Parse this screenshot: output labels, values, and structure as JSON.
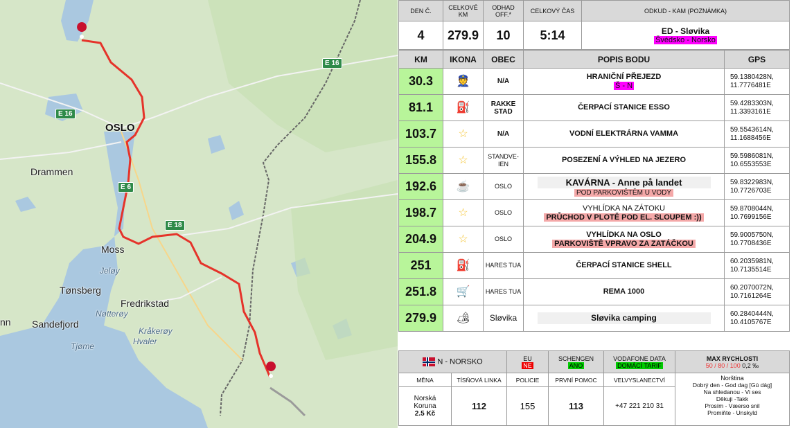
{
  "map": {
    "labels": {
      "oslo": "OSLO",
      "drammen": "Drammen",
      "moss": "Moss",
      "jeloy": "Jeløy",
      "tonsberg": "Tønsberg",
      "fredrikstad": "Fredrikstad",
      "sandefjord": "Sandefjord",
      "notteroy": "Nøtterøy",
      "kraakeroy": "Kråkerøy",
      "hvaler": "Hvaler",
      "tjome": "Tjøme",
      "nn": "nn"
    },
    "roads": [
      "E 16",
      "E 16",
      "E 16",
      "E 6",
      "E 18"
    ]
  },
  "summary": {
    "headers": [
      "DEN Č.",
      "CELKOVÉ KM",
      "ODHAD OFF.*",
      "CELKOVÝ ČAS",
      "ODKUD - KAM (POZNÁMKA)"
    ],
    "den": "4",
    "km": "279.9",
    "odhad": "10",
    "cas": "5:14",
    "route": "ED - Sløvika",
    "route_note": "Švédsko - Norsko"
  },
  "points": {
    "headers": [
      "KM",
      "IKONA",
      "OBEC",
      "POPIS BODU",
      "GPS"
    ],
    "rows": [
      {
        "km": "30.3",
        "icon": "border-officer-icon",
        "obec": "N/A",
        "desc": "HRANIČNÍ PŘEJEZD",
        "note": "Š - N",
        "gps1": "59.1380428N,",
        "gps2": "11.7776481E"
      },
      {
        "km": "81.1",
        "icon": "fuel-pump-icon",
        "obec": "RAKKE STAD",
        "desc": "ČERPACÍ STANICE ESSO",
        "note": "",
        "gps1": "59.4283303N,",
        "gps2": "11.3393161E"
      },
      {
        "km": "103.7",
        "icon": "star-icon",
        "obec": "N/A",
        "desc": "VODNÍ ELEKTRÁRNA VAMMA",
        "note": "",
        "gps1": "59.5543614N,",
        "gps2": "11.1688456E"
      },
      {
        "km": "155.8",
        "icon": "star-icon",
        "obec": "STANDVE-IEN",
        "desc": "POSEZENÍ A VÝHLED NA JEZERO",
        "note": "",
        "gps1": "59.5986081N,",
        "gps2": "10.6553553E"
      },
      {
        "km": "192.6",
        "icon": "coffee-cup-icon",
        "obec": "OSLO",
        "desc": "KAVÁRNA - Anne på landet",
        "note": "POD PARKOVIŠTĚM U VODY",
        "gps1": "59.8322983N,",
        "gps2": "10.7726703E"
      },
      {
        "km": "198.7",
        "icon": "star-icon",
        "obec": "OSLO",
        "desc": "VYHLÍDKA NA ZÁTOKU",
        "note": "PRŮCHOD V PLOTĚ POD EL. SLOUPEM :))",
        "gps1": "59.8708044N,",
        "gps2": "10.7699156E"
      },
      {
        "km": "204.9",
        "icon": "star-icon",
        "obec": "OSLO",
        "desc": "VYHLÍDKA NA OSLO",
        "note": "PARKOVIŠTĚ VPRAVO ZA ZATÁČKOU",
        "gps1": "59.9005750N,",
        "gps2": "10.7708436E"
      },
      {
        "km": "251",
        "icon": "fuel-pump-icon",
        "obec": "HARES TUA",
        "desc": "ČERPACÍ STANICE SHELL",
        "note": "",
        "gps1": "60.2035981N,",
        "gps2": "10.7135514E"
      },
      {
        "km": "251.8",
        "icon": "shopping-cart-icon",
        "obec": "HARES TUA",
        "desc": "REMA 1000",
        "note": "",
        "gps1": "60.2070072N,",
        "gps2": "10.7161264E"
      },
      {
        "km": "279.9",
        "icon": "camping-icon",
        "obec": "Sløvika",
        "desc": "Sløvika camping",
        "note": "",
        "gps1": "60.2840444N,",
        "gps2": "10.4105767E"
      }
    ]
  },
  "country": {
    "name": "N - NORSKO",
    "eu_label": "EU",
    "eu_value": "NE",
    "schengen_label": "SCHENGEN",
    "schengen_value": "ANO",
    "vodafone_label": "VODAFONE DATA",
    "vodafone_value": "DOMÁCÍ TARIF",
    "speed_label": "MAX RYCHLOSTI",
    "speed_value": "50 / 80 / 100",
    "alcohol": "0,2 ‰",
    "labels": [
      "MĚNA",
      "TÍSŇOVÁ LINKA",
      "POLICIE",
      "PRVNÍ POMOC",
      "VELVYSLANECTVÍ"
    ],
    "currency1": "Norská",
    "currency2": "Koruna",
    "currency3": "2.5 Kč",
    "emergency": "112",
    "police": "155",
    "firstaid": "113",
    "embassy": "+47 221 210 31",
    "language_title": "Norština",
    "phrases": [
      "Dobrý den - God dag [Gú dág]",
      "Na shledanou - Vi ses",
      "Děkuji -Takk",
      "Prosím - Væerso snil",
      "Promiňte - Unskyld"
    ]
  },
  "colors": {
    "route": "#e5332a",
    "km_bg": "#b8f59a",
    "note_pink": "#ff00ff",
    "note_salmon": "#f4a8a8"
  }
}
